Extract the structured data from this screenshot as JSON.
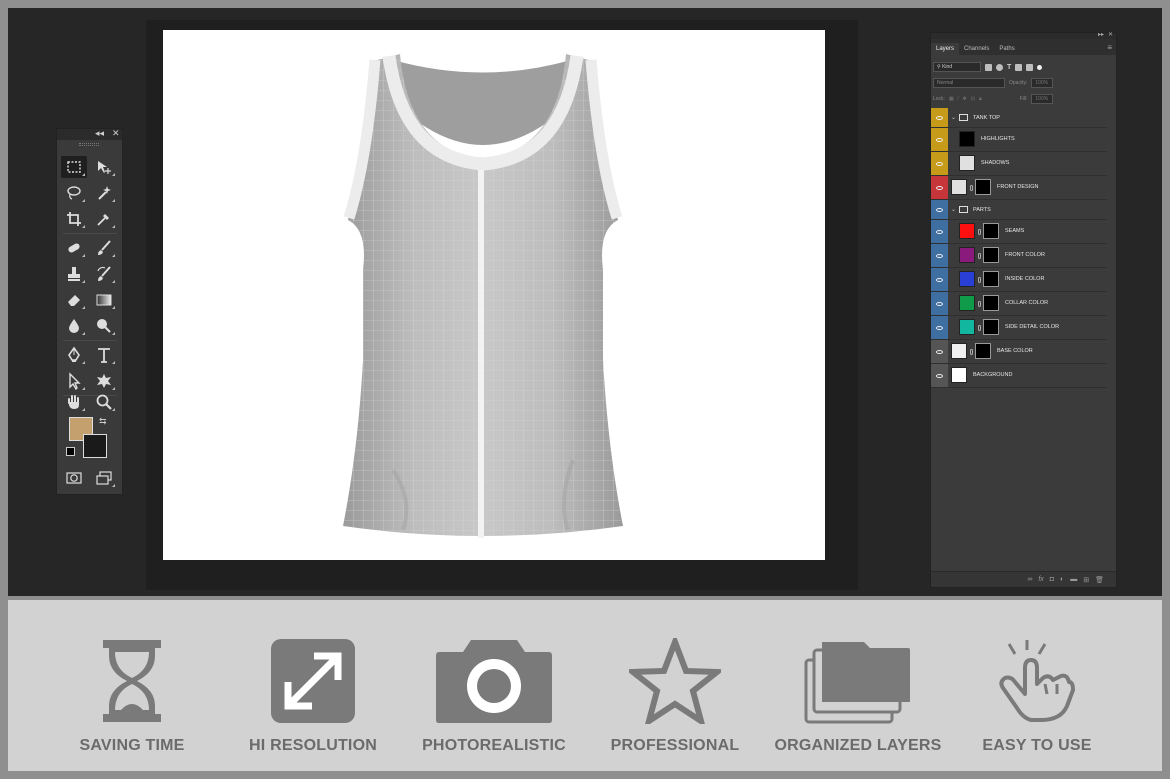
{
  "toolbox": {
    "collapse_icon": "double-chevron-icon",
    "close_icon": "close-icon",
    "foreground_color": "#c4a06e",
    "background_color": "#1a1a1a",
    "tools": [
      "rectangular-marquee",
      "move",
      "lasso",
      "magic-wand",
      "crop",
      "eyedropper",
      "spot-healing",
      "brush",
      "clone-stamp",
      "history-brush",
      "eraser",
      "gradient",
      "blur",
      "dodge",
      "pen",
      "type",
      "path-selection",
      "custom-shape",
      "hand",
      "zoom",
      "quick-mask",
      "screen-mode"
    ]
  },
  "layers_panel": {
    "tabs": [
      "Layers",
      "Channels",
      "Paths"
    ],
    "filter_kind": "Kind",
    "blend_mode": "Normal",
    "opacity_label": "Opacity:",
    "opacity_value": "100%",
    "lock_label": "Lock:",
    "fill_label": "Fill:",
    "fill_value": "100%",
    "layers": [
      {
        "name": "TANK TOP",
        "type": "group",
        "tag": "#c79b1a"
      },
      {
        "name": "HIGHLIGHTS",
        "type": "layer",
        "tag": "#c79b1a",
        "thumb": "#000000"
      },
      {
        "name": "SHADOWS",
        "type": "layer",
        "tag": "#c79b1a",
        "thumb": "#e0e0e0"
      },
      {
        "name": "FRONT DESIGN",
        "type": "smart",
        "tag": "#c6353a",
        "thumb": "#e0e0e0"
      },
      {
        "name": "PARTS",
        "type": "group",
        "tag": "#3f6ea0"
      },
      {
        "name": "SEAMS",
        "type": "fill",
        "tag": "#3f6ea0",
        "thumb": "#ff1010"
      },
      {
        "name": "FRONT COLOR",
        "type": "fill",
        "tag": "#3f6ea0",
        "thumb": "#8a1a7c"
      },
      {
        "name": "INSIDE COLOR",
        "type": "fill",
        "tag": "#3f6ea0",
        "thumb": "#2a3fd6"
      },
      {
        "name": "COLLAR COLOR",
        "type": "fill",
        "tag": "#3f6ea0",
        "thumb": "#0f9b4a"
      },
      {
        "name": "SIDE DETAIL COLOR",
        "type": "fill",
        "tag": "#3f6ea0",
        "thumb": "#12b7a0"
      },
      {
        "name": "BASE COLOR",
        "type": "fill",
        "tag": "#555555",
        "thumb": "#f0f0f0"
      },
      {
        "name": "BACKGROUND",
        "type": "layer",
        "tag": "#555555",
        "thumb": "#ffffff"
      }
    ],
    "footer_icons": [
      "link-icon",
      "fx-icon",
      "mask-icon",
      "adjustment-icon",
      "folder-icon",
      "new-layer-icon",
      "trash-icon"
    ]
  },
  "features": [
    {
      "label": "SAVING TIME",
      "icon": "hourglass-icon"
    },
    {
      "label": "HI RESOLUTION",
      "icon": "expand-arrows-icon"
    },
    {
      "label": "PHOTOREALISTIC",
      "icon": "camera-icon"
    },
    {
      "label": "PROFESSIONAL",
      "icon": "star-icon"
    },
    {
      "label": "ORGANIZED LAYERS",
      "icon": "stacked-folders-icon"
    },
    {
      "label": "EASY TO USE",
      "icon": "tap-hand-icon"
    }
  ],
  "colors": {
    "workspace": "#262626",
    "feature_bar": "#d2d2d2",
    "feature_icon": "#7a7a7a",
    "shirt": "#b3b3b3"
  }
}
